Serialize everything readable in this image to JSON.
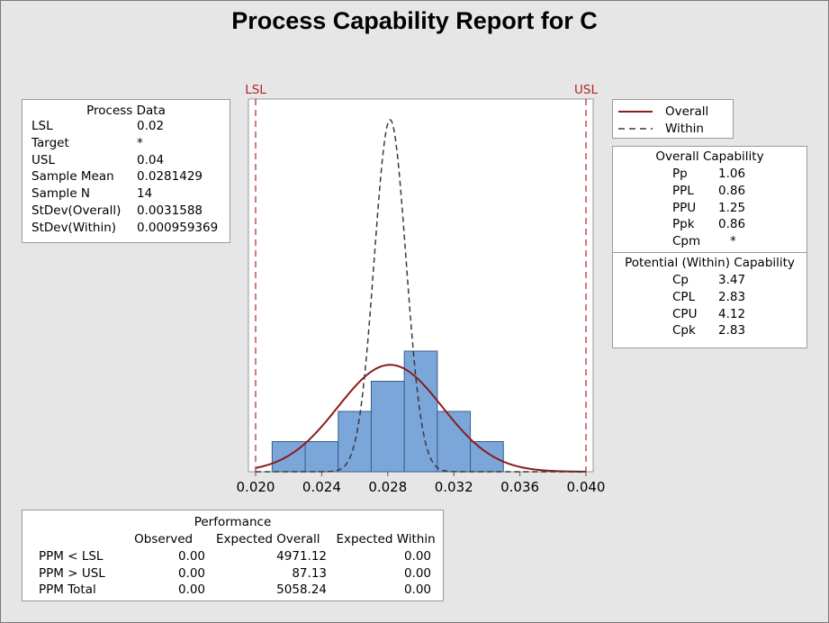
{
  "title": "Process Capability Report for C",
  "process_data": {
    "header": "Process Data",
    "rows": [
      {
        "label": "LSL",
        "value": "0.02"
      },
      {
        "label": "Target",
        "value": "*"
      },
      {
        "label": "USL",
        "value": "0.04"
      },
      {
        "label": "Sample Mean",
        "value": "0.0281429"
      },
      {
        "label": "Sample N",
        "value": "14"
      },
      {
        "label": "StDev(Overall)",
        "value": "0.0031588"
      },
      {
        "label": "StDev(Within)",
        "value": "0.000959369"
      }
    ]
  },
  "legend": [
    {
      "name": "Overall",
      "style": "solid",
      "color": "#8b1c1c"
    },
    {
      "name": "Within",
      "style": "dashed",
      "color": "#3a3a3a"
    }
  ],
  "overall_capability": {
    "header": "Overall Capability",
    "rows": [
      {
        "label": "Pp",
        "value": "1.06"
      },
      {
        "label": "PPL",
        "value": "0.86"
      },
      {
        "label": "PPU",
        "value": "1.25"
      },
      {
        "label": "Ppk",
        "value": "0.86"
      },
      {
        "label": "Cpm",
        "value": "*"
      }
    ]
  },
  "within_capability": {
    "header": "Potential (Within) Capability",
    "rows": [
      {
        "label": "Cp",
        "value": "3.47"
      },
      {
        "label": "CPL",
        "value": "2.83"
      },
      {
        "label": "CPU",
        "value": "4.12"
      },
      {
        "label": "Cpk",
        "value": "2.83"
      }
    ]
  },
  "performance": {
    "header": "Performance",
    "columns": [
      "",
      "Observed",
      "Expected Overall",
      "Expected Within"
    ],
    "rows": [
      [
        "PPM < LSL",
        "0.00",
        "4971.12",
        "0.00"
      ],
      [
        "PPM > USL",
        "0.00",
        "87.13",
        "0.00"
      ],
      [
        "PPM Total",
        "0.00",
        "5058.24",
        "0.00"
      ]
    ]
  },
  "chart_data": {
    "type": "bar",
    "xlim": [
      0.02,
      0.04
    ],
    "xticks": [
      "0.020",
      "0.024",
      "0.028",
      "0.032",
      "0.036",
      "0.040"
    ],
    "bins": [
      {
        "from": 0.021,
        "to": 0.023,
        "count": 1
      },
      {
        "from": 0.023,
        "to": 0.025,
        "count": 1
      },
      {
        "from": 0.025,
        "to": 0.027,
        "count": 2
      },
      {
        "from": 0.027,
        "to": 0.029,
        "count": 3
      },
      {
        "from": 0.029,
        "to": 0.031,
        "count": 4
      },
      {
        "from": 0.031,
        "to": 0.033,
        "count": 2
      },
      {
        "from": 0.033,
        "to": 0.035,
        "count": 1
      }
    ],
    "spec_limits": [
      {
        "label": "LSL",
        "value": 0.02
      },
      {
        "label": "USL",
        "value": 0.04
      }
    ],
    "curves": [
      {
        "name": "Overall",
        "mean": 0.0281429,
        "sd": 0.0031588
      },
      {
        "name": "Within",
        "mean": 0.0281429,
        "sd": 0.000959369
      }
    ],
    "colors": {
      "bar": "#7ba6d9",
      "bar_edge": "#3d5d8a",
      "overall": "#8b1c1c",
      "within": "#3a3a3a",
      "spec": "#b22222"
    }
  }
}
